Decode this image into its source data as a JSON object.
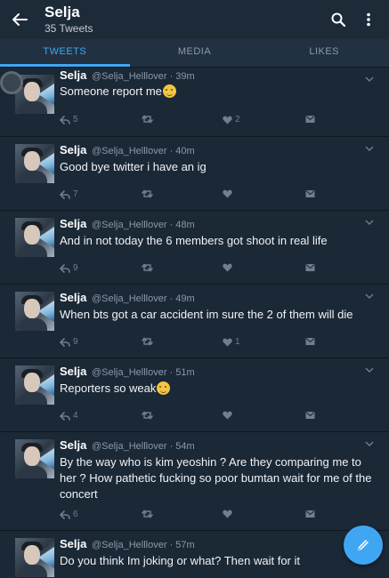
{
  "header": {
    "title": "Selja",
    "subtitle": "35 Tweets",
    "back_icon": "arrow-left-icon",
    "search_icon": "search-icon",
    "menu_icon": "more-vertical-icon"
  },
  "tabs": [
    {
      "label": "TWEETS",
      "active": true
    },
    {
      "label": "MEDIA",
      "active": false
    },
    {
      "label": "LIKES",
      "active": false
    }
  ],
  "colors": {
    "accent": "#3fa6f4",
    "background": "#1b2836",
    "muted": "#8a99a8"
  },
  "tweets": [
    {
      "name": "Selja",
      "handle": "@Selja_Helllover",
      "time": "39m",
      "text": "Someone report me",
      "emoji": true,
      "replies": "5",
      "retweets": "",
      "likes": "2"
    },
    {
      "name": "Selja",
      "handle": "@Selja_Helllover",
      "time": "40m",
      "text": "Good bye twitter i have an ig",
      "emoji": false,
      "replies": "7",
      "retweets": "",
      "likes": ""
    },
    {
      "name": "Selja",
      "handle": "@Selja_Helllover",
      "time": "48m",
      "text": "And in not today the 6 members got shoot in real life",
      "emoji": false,
      "replies": "9",
      "retweets": "",
      "likes": ""
    },
    {
      "name": "Selja",
      "handle": "@Selja_Helllover",
      "time": "49m",
      "text": "When bts got a car accident im sure the 2 of them will die",
      "emoji": false,
      "replies": "9",
      "retweets": "",
      "likes": "1"
    },
    {
      "name": "Selja",
      "handle": "@Selja_Helllover",
      "time": "51m",
      "text": "Reporters so weak",
      "emoji": true,
      "replies": "4",
      "retweets": "",
      "likes": ""
    },
    {
      "name": "Selja",
      "handle": "@Selja_Helllover",
      "time": "54m",
      "text": "By the way who is kim yeoshin ? Are they comparing me to her ? How pathetic fucking so poor bumtan wait for me of the concert",
      "emoji": false,
      "replies": "6",
      "retweets": "",
      "likes": ""
    },
    {
      "name": "Selja",
      "handle": "@Selja_Helllover",
      "time": "57m",
      "text": "Do you think Im joking or what? Then wait for it",
      "emoji": false,
      "replies": "",
      "retweets": "",
      "likes": ""
    }
  ],
  "fab": {
    "icon": "compose-tweet-icon"
  }
}
